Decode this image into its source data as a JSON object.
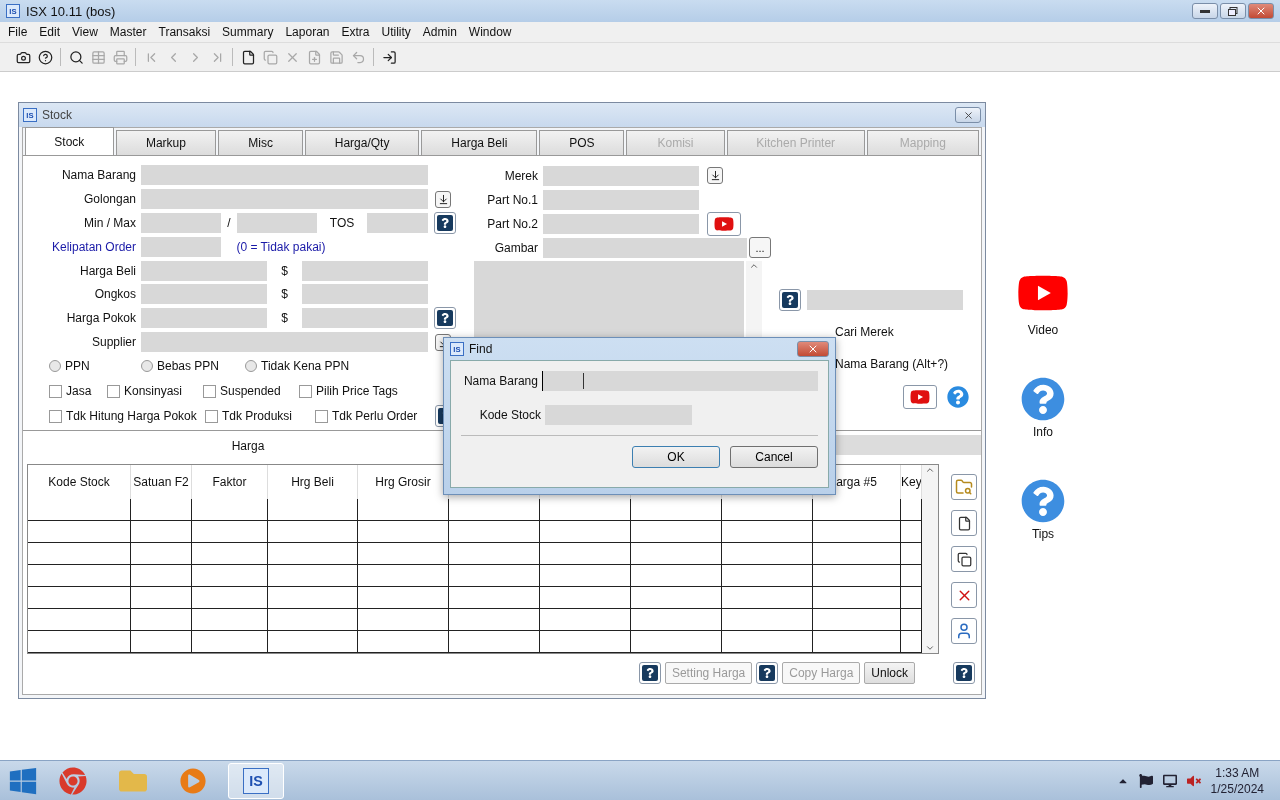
{
  "app": {
    "logo": "IS",
    "title": "ISX 10.11 (bos)"
  },
  "menu": [
    "File",
    "Edit",
    "View",
    "Master",
    "Transaksi",
    "Summary",
    "Laporan",
    "Extra",
    "Utility",
    "Admin",
    "Window"
  ],
  "toolbar": [
    [
      {
        "kind": "camera",
        "disabled": false
      },
      {
        "kind": "help",
        "disabled": false
      }
    ],
    [
      {
        "kind": "search",
        "disabled": false
      },
      {
        "kind": "table",
        "disabled": true
      },
      {
        "kind": "print",
        "disabled": true
      }
    ],
    [
      {
        "kind": "first",
        "disabled": true
      },
      {
        "kind": "prev",
        "disabled": true
      },
      {
        "kind": "next",
        "disabled": true
      },
      {
        "kind": "last",
        "disabled": true
      }
    ],
    [
      {
        "kind": "new",
        "disabled": false
      },
      {
        "kind": "copy",
        "disabled": true
      },
      {
        "kind": "delete",
        "disabled": true
      },
      {
        "kind": "add",
        "disabled": true
      },
      {
        "kind": "save",
        "disabled": true
      },
      {
        "kind": "undo",
        "disabled": true
      }
    ],
    [
      {
        "kind": "exit",
        "disabled": false
      }
    ]
  ],
  "stock_window": {
    "logo": "IS",
    "title": "Stock",
    "tabs": [
      {
        "label": "Stock",
        "selected": true,
        "disabled": false
      },
      {
        "label": "Markup",
        "selected": false,
        "disabled": false
      },
      {
        "label": "Misc",
        "selected": false,
        "disabled": false
      },
      {
        "label": "Harga/Qty",
        "selected": false,
        "disabled": false
      },
      {
        "label": "Harga Beli",
        "selected": false,
        "disabled": false
      },
      {
        "label": "POS",
        "selected": false,
        "disabled": false
      },
      {
        "label": "Komisi",
        "selected": false,
        "disabled": true
      },
      {
        "label": "Kitchen Printer",
        "selected": false,
        "disabled": true
      },
      {
        "label": "Mapping",
        "selected": false,
        "disabled": true
      }
    ],
    "left_fields": [
      {
        "kind": "wide",
        "label": "Nama Barang"
      },
      {
        "kind": "lookup",
        "label": "Golongan"
      },
      {
        "kind": "minmax",
        "label": "Min / Max",
        "separator": "/",
        "extra_label": "TOS"
      },
      {
        "kind": "note",
        "label": "Kelipatan Order",
        "note": "(0 = Tidak pakai)"
      },
      {
        "kind": "money",
        "label": "Harga Beli",
        "currency": "$",
        "help": false
      },
      {
        "kind": "money",
        "label": "Ongkos",
        "currency": "$",
        "help": false
      },
      {
        "kind": "money",
        "label": "Harga Pokok",
        "currency": "$",
        "help": true
      },
      {
        "kind": "lookup",
        "label": "Supplier"
      }
    ],
    "tax": [
      {
        "label": "PPN",
        "selected": false
      },
      {
        "label": "Bebas PPN",
        "selected": false
      },
      {
        "label": "Tidak Kena PPN",
        "selected": false
      }
    ],
    "options": [
      {
        "label": "Jasa",
        "checked": false
      },
      {
        "label": "Konsinyasi",
        "checked": false
      },
      {
        "label": "Suspended",
        "checked": false
      },
      {
        "label": "Pilih Price Tags",
        "checked": false
      },
      {
        "label": "Tdk Hitung Harga Pokok",
        "checked": false
      },
      {
        "label": "Tdk Produksi",
        "checked": false
      },
      {
        "label": "Tdk Perlu Order",
        "checked": false
      }
    ],
    "right_fields": [
      {
        "kind": "lookup",
        "label": "Merek"
      },
      {
        "kind": "plain",
        "label": "Part No.1"
      },
      {
        "kind": "video",
        "label": "Part No.2"
      },
      {
        "kind": "browse",
        "label": "Gambar",
        "button": "..."
      }
    ],
    "search_links": [
      "Cari Merek",
      "Nama Barang (Alt+?)"
    ],
    "harga": {
      "tab": "Harga",
      "columns": [
        "Kode Stock",
        "Satuan F2",
        "Faktor",
        "Hrg Beli",
        "Hrg Grosir",
        "arga #5",
        "Key"
      ],
      "buttons": [
        {
          "label": "Setting Harga",
          "disabled": true
        },
        {
          "label": "Copy Harga",
          "disabled": true
        },
        {
          "label": "Unlock",
          "disabled": false
        }
      ]
    }
  },
  "find_dialog": {
    "logo": "IS",
    "title": "Find",
    "fields": [
      {
        "label": "Nama Barang",
        "focused": true
      },
      {
        "label": "Kode Stock",
        "focused": false
      }
    ],
    "buttons": [
      "OK",
      "Cancel"
    ]
  },
  "desktop_icons": [
    {
      "kind": "video",
      "label": "Video"
    },
    {
      "kind": "help",
      "label": "Info"
    },
    {
      "kind": "help",
      "label": "Tips"
    }
  ],
  "taskbar": {
    "apps": [
      {
        "kind": "chrome",
        "active": false
      },
      {
        "kind": "folder",
        "active": false
      },
      {
        "kind": "media",
        "active": false
      },
      {
        "kind": "logo",
        "label": "IS",
        "active": true
      }
    ],
    "time": "1:33 AM",
    "date": "1/25/2024"
  }
}
